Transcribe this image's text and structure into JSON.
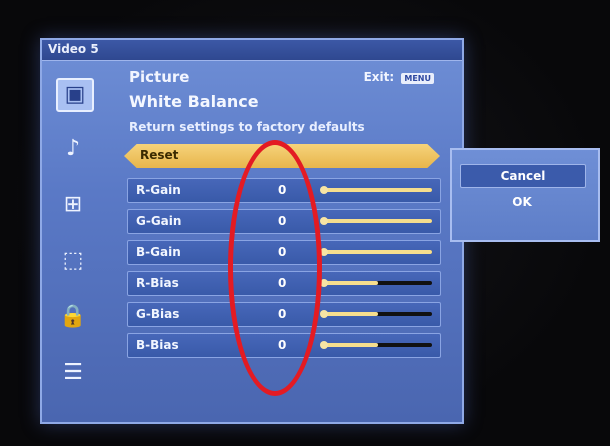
{
  "window": {
    "source_label": "Video 5"
  },
  "header": {
    "picture": "Picture",
    "exit": "Exit:",
    "exit_button": "MENU",
    "section": "White Balance",
    "description": "Return settings to factory defaults"
  },
  "reset": {
    "label": "Reset"
  },
  "settings": [
    {
      "label": "R-Gain",
      "value": "0",
      "level": 1.0
    },
    {
      "label": "G-Gain",
      "value": "0",
      "level": 1.0
    },
    {
      "label": "B-Gain",
      "value": "0",
      "level": 1.0
    },
    {
      "label": "R-Bias",
      "value": "0",
      "level": 0.5
    },
    {
      "label": "G-Bias",
      "value": "0",
      "level": 0.5
    },
    {
      "label": "B-Bias",
      "value": "0",
      "level": 0.5
    }
  ],
  "dialog": {
    "cancel": "Cancel",
    "ok": "OK"
  },
  "side_icons": [
    "picture-icon",
    "audio-icon",
    "screen-format-icon",
    "input-icon",
    "lock-icon",
    "setup-icon"
  ],
  "colors": {
    "menu_blue": "#5a79c6",
    "reset_gold": "#e7b54c",
    "slider_fill": "#f6de8e",
    "annotation_red": "#e31b23"
  }
}
